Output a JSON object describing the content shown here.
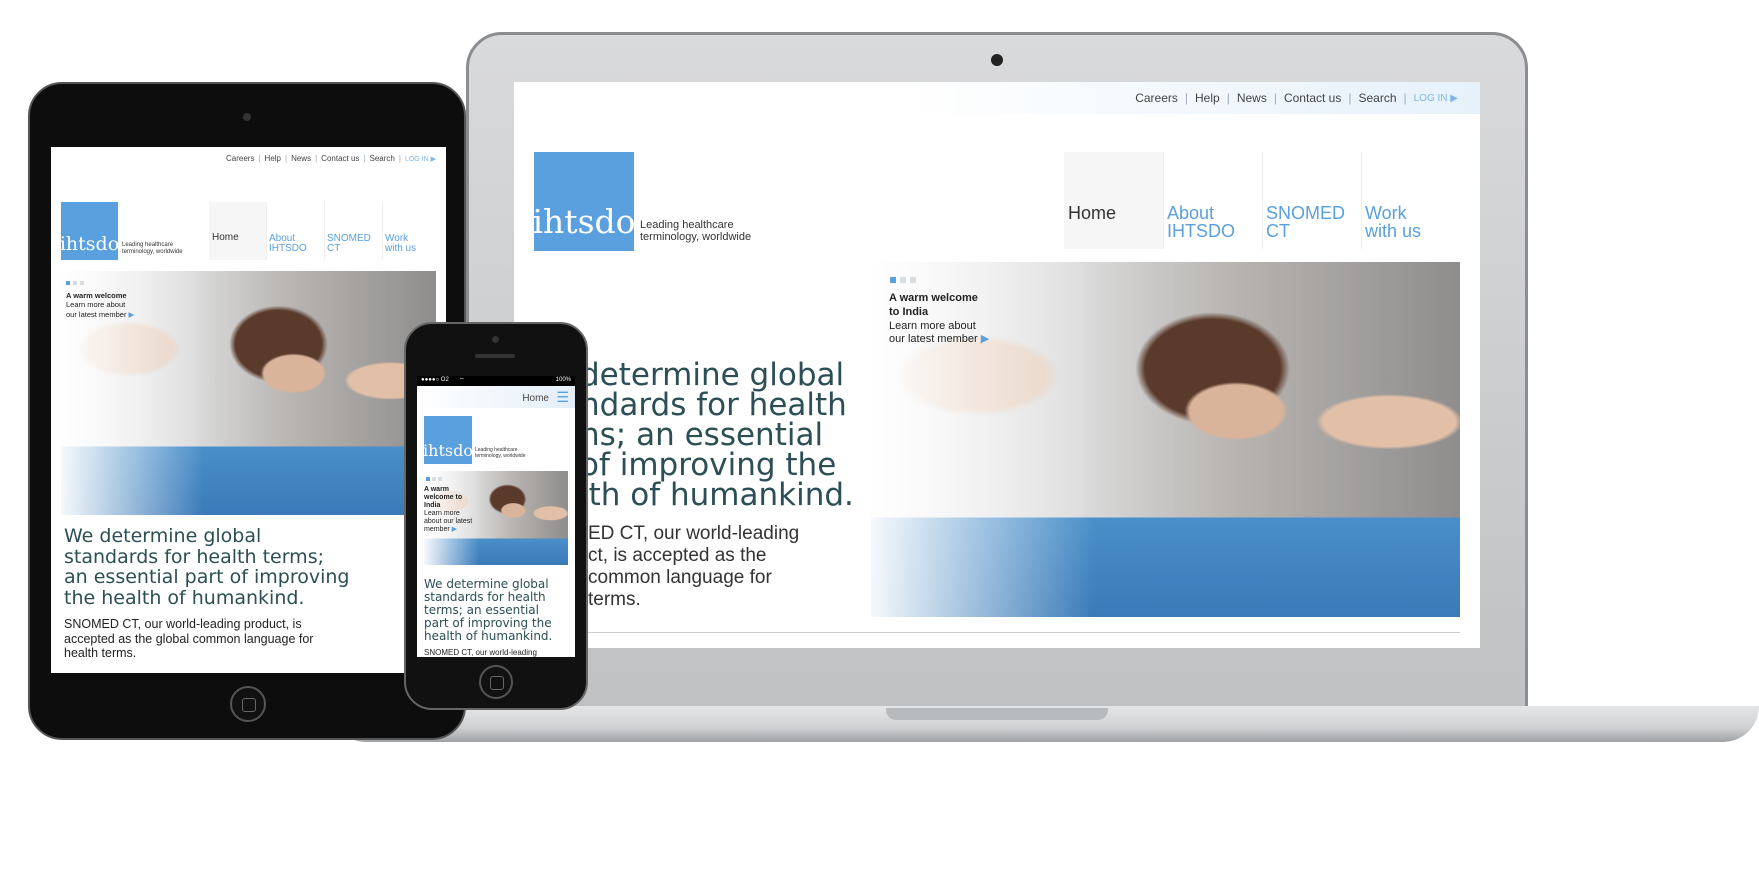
{
  "site": {
    "topnav": [
      "Careers",
      "Help",
      "News",
      "Contact us",
      "Search"
    ],
    "login": "LOG IN ▶",
    "logo": "ihtsdo",
    "tagline_1": "Leading healthcare",
    "tagline_2": "terminology, worldwide",
    "mainnav": {
      "home": "Home",
      "about_1": "About",
      "about_2": "IHTSDO",
      "snomed_1": "SNOMED",
      "snomed_2": "CT",
      "work_1": "Work",
      "work_2": "with us"
    },
    "carousel": {
      "title_1": "A warm welcome",
      "title_2": "to India",
      "link_1": "Learn more about",
      "link_2": "our latest member",
      "arrow": "▶"
    },
    "headline_lines": [
      "We determine global",
      "standards for health terms;",
      "an essential part of improving",
      "the health of humankind."
    ],
    "body_lines": [
      "SNOMED CT, our world-leading product, is",
      "accepted as the global common language for",
      "health terms."
    ]
  },
  "laptop": {
    "headline_lines": [
      "determine global",
      "ndards for health",
      "ns; an essential",
      "of improving the",
      "lth of humankind."
    ],
    "body_lines": [
      "ED CT, our world-leading",
      "ct, is accepted as the",
      "common language for",
      "terms."
    ]
  },
  "phone": {
    "status_carrier": "●●●●○ O2",
    "status_wifi": "⌔",
    "status_battery": "100%",
    "nav_label": "Home",
    "menu_icon": "☰",
    "carousel_1": "A warm",
    "carousel_2": "welcome to",
    "carousel_3": "India",
    "link_1": "Learn more",
    "link_2": "about our latest",
    "link_3": "member",
    "headline_lines": [
      "We determine global",
      "standards for health",
      "terms; an essential",
      "part of improving the",
      "health of humankind."
    ],
    "body_cut": "SNOMED CT, our world-leading"
  }
}
